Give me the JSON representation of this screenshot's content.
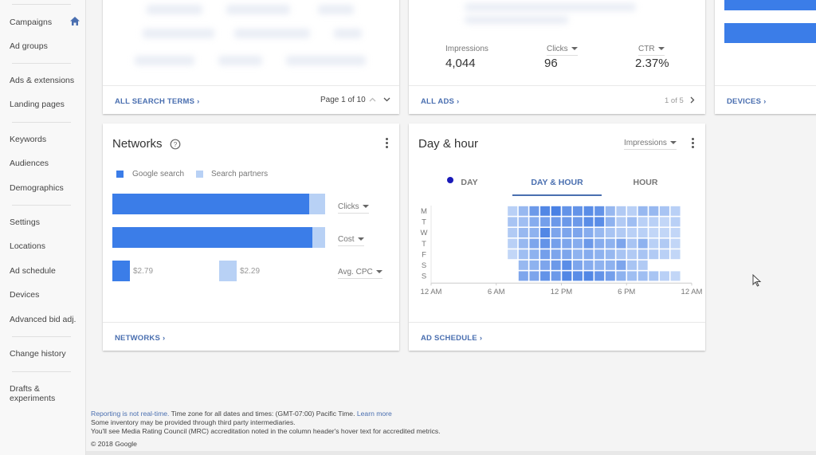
{
  "sidebar": {
    "items": [
      {
        "label": "Campaigns",
        "active": true
      },
      {
        "label": "Ad groups"
      },
      {
        "label": "Ads & extensions"
      },
      {
        "label": "Landing pages"
      },
      {
        "label": "Keywords"
      },
      {
        "label": "Audiences"
      },
      {
        "label": "Demographics"
      },
      {
        "label": "Settings"
      },
      {
        "label": "Locations"
      },
      {
        "label": "Ad schedule"
      },
      {
        "label": "Devices"
      },
      {
        "label": "Advanced bid adj."
      },
      {
        "label": "Change history"
      },
      {
        "label": "Drafts & experiments"
      }
    ],
    "home_icon": "home-icon"
  },
  "search_terms_card": {
    "footer_link": "ALL SEARCH TERMS",
    "pagination": "Page 1 of 10"
  },
  "ads_card": {
    "stats": [
      {
        "label": "Impressions",
        "value": "4,044",
        "dropdown": false
      },
      {
        "label": "Clicks",
        "value": "96",
        "dropdown": true
      },
      {
        "label": "CTR",
        "value": "2.37%",
        "dropdown": true
      }
    ],
    "footer_link": "ALL ADS",
    "pagination": "1 of 5"
  },
  "devices_card": {
    "footer_link": "DEVICES"
  },
  "networks_card": {
    "title": "Networks",
    "legend": [
      {
        "label": "Google search",
        "color": "#3b7de8"
      },
      {
        "label": "Search partners",
        "color": "#b8d1f5"
      }
    ],
    "metrics": [
      {
        "label": "Clicks",
        "google_share": 0.925,
        "partners_share": 0.075
      },
      {
        "label": "Cost",
        "google_share": 0.94,
        "partners_share": 0.06
      },
      {
        "label": "Avg. CPC",
        "google_value": "$2.79",
        "partners_value": "$2.29"
      }
    ],
    "footer_link": "NETWORKS"
  },
  "day_hour_card": {
    "title": "Day & hour",
    "metric_dropdown": "Impressions",
    "tabs": [
      {
        "label": "DAY",
        "active": false
      },
      {
        "label": "DAY & HOUR",
        "active": true
      },
      {
        "label": "HOUR",
        "active": false
      }
    ],
    "footer_link": "AD SCHEDULE"
  },
  "chart_data": {
    "type": "heatmap",
    "title": "Day & hour",
    "metric": "Impressions",
    "rows": [
      "M",
      "T",
      "W",
      "T",
      "F",
      "S",
      "S"
    ],
    "x_ticks": [
      "12 AM",
      "6 AM",
      "12 PM",
      "6 PM",
      "12 AM"
    ],
    "x_range_hours": [
      0,
      24
    ],
    "start_hour": 7,
    "hours": [
      7,
      8,
      9,
      10,
      11,
      12,
      13,
      14,
      15,
      16,
      17,
      18,
      19,
      20,
      21,
      22
    ],
    "intensity": [
      [
        0.2,
        0.4,
        0.65,
        0.8,
        0.85,
        0.7,
        0.7,
        0.75,
        0.7,
        0.4,
        0.25,
        0.2,
        0.4,
        0.4,
        0.3,
        0.2
      ],
      [
        0.3,
        0.35,
        0.5,
        0.6,
        0.65,
        0.65,
        0.65,
        0.75,
        0.75,
        0.45,
        0.25,
        0.35,
        0.2,
        0.2,
        0.15,
        0.2
      ],
      [
        0.25,
        0.4,
        0.45,
        0.8,
        0.55,
        0.55,
        0.55,
        0.5,
        0.4,
        0.3,
        0.25,
        0.2,
        0.2,
        0.15,
        0.15,
        0.15
      ],
      [
        0.2,
        0.4,
        0.55,
        0.7,
        0.6,
        0.55,
        0.5,
        0.65,
        0.5,
        0.45,
        0.55,
        0.3,
        0.45,
        0.2,
        0.25,
        0.15
      ],
      [
        0.15,
        0.35,
        0.45,
        0.6,
        0.55,
        0.55,
        0.45,
        0.5,
        0.45,
        0.4,
        0.3,
        0.25,
        0.3,
        0.25,
        0.2,
        0.15
      ],
      [
        null,
        0.4,
        0.45,
        0.55,
        0.65,
        0.75,
        0.55,
        0.5,
        0.45,
        0.45,
        0.55,
        0.3,
        0.25,
        null,
        null,
        null
      ],
      [
        null,
        0.55,
        0.55,
        0.7,
        0.65,
        0.8,
        0.75,
        0.8,
        0.7,
        0.6,
        0.45,
        0.35,
        0.35,
        0.3,
        0.2,
        0.15
      ]
    ],
    "color_low": "#dce8fb",
    "color_high": "#2f6fe0"
  },
  "footer": {
    "realtime_link": "Reporting is not real-time.",
    "timezone_text": " Time zone for all dates and times: (GMT-07:00) Pacific Time. ",
    "learn_more": "Learn more",
    "line2": "Some inventory may be provided through third party intermediaries.",
    "line3": "You'll see Media Rating Council (MRC) accreditation noted in the column header's hover text for accredited metrics.",
    "copyright": "© 2018 Google"
  }
}
